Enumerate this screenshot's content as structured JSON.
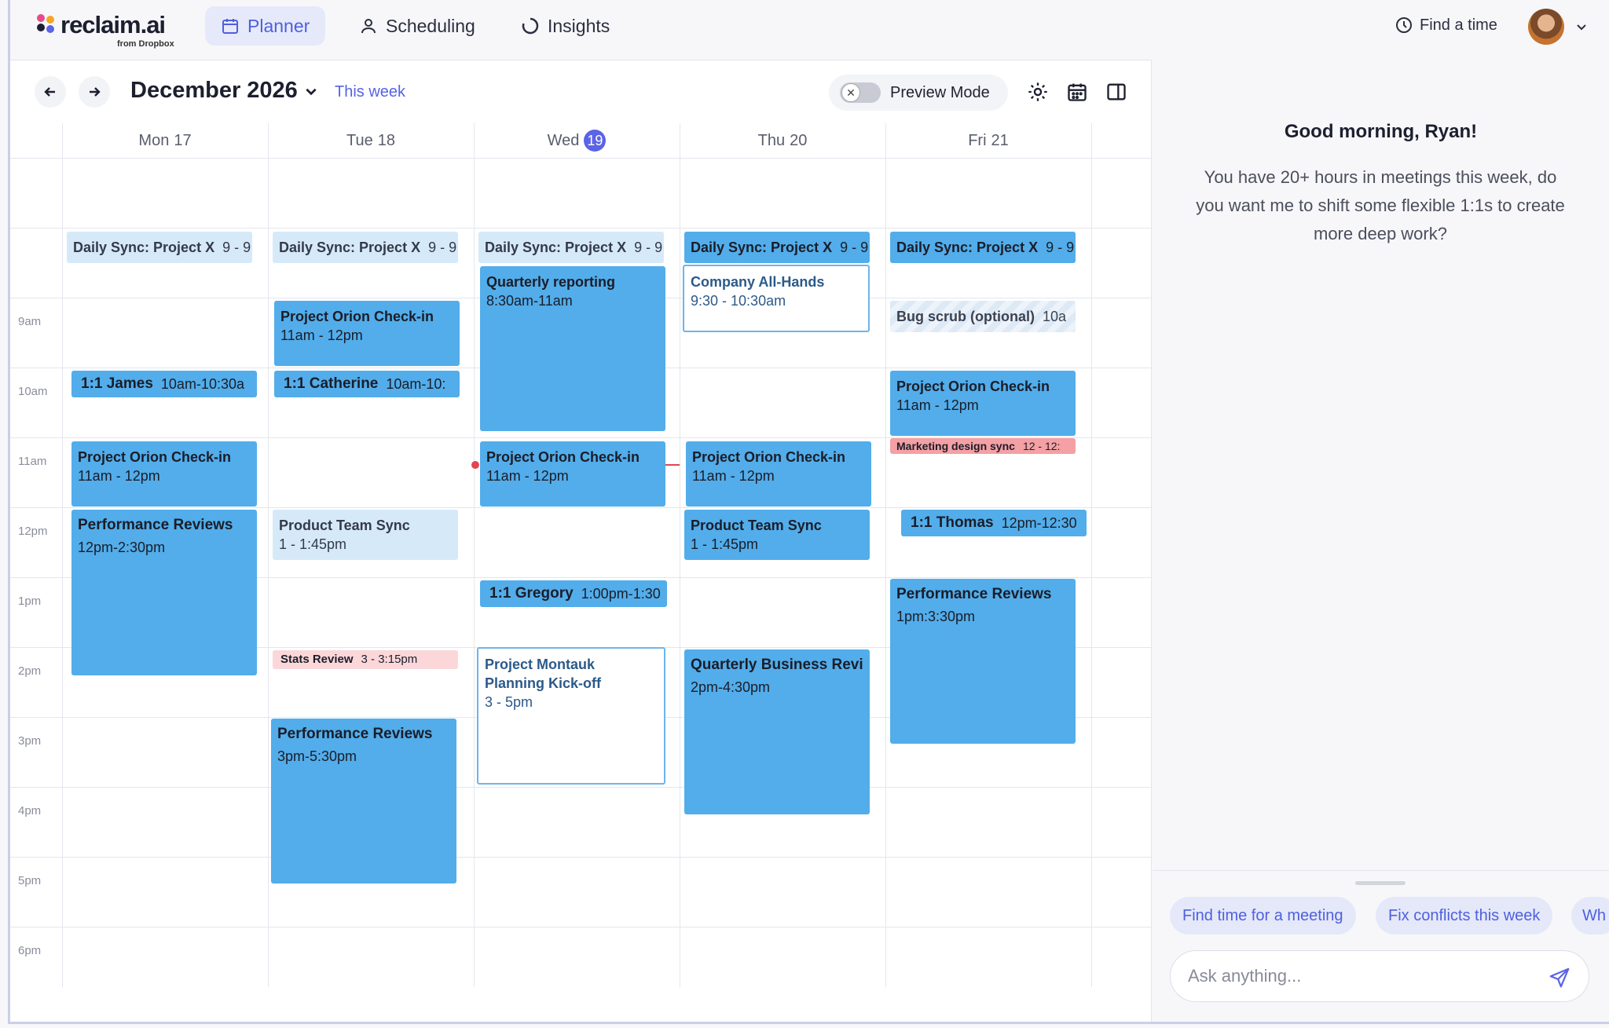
{
  "brand": {
    "name": "reclaim.ai",
    "sub": "from Dropbox"
  },
  "nav": {
    "tabs": [
      {
        "label": "Planner"
      },
      {
        "label": "Scheduling"
      },
      {
        "label": "Insights"
      }
    ],
    "find_time": "Find a time"
  },
  "toolbar": {
    "month": "December 2026",
    "this_week": "This week",
    "preview_mode": "Preview Mode"
  },
  "days": [
    {
      "name": "Mon",
      "num": "17"
    },
    {
      "name": "Tue",
      "num": "18"
    },
    {
      "name": "Wed",
      "num": "19"
    },
    {
      "name": "Thu",
      "num": "20"
    },
    {
      "name": "Fri",
      "num": "21"
    }
  ],
  "hours": [
    "9am",
    "10am",
    "11am",
    "12pm",
    "1pm",
    "2pm",
    "3pm",
    "4pm",
    "5pm",
    "6pm"
  ],
  "events": {
    "mon": [
      {
        "title": "Daily Sync: Project X",
        "time": "9 - 9"
      },
      {
        "title": "1:1 James",
        "time": "10am-10:30a"
      },
      {
        "title": "Project Orion Check-in",
        "time": "11am - 12pm"
      },
      {
        "title": "Performance Reviews",
        "time": "12pm-2:30pm"
      }
    ],
    "tue": [
      {
        "title": "Daily Sync: Project X",
        "time": "9 - 9"
      },
      {
        "title": "Project Orion Check-in",
        "time": "11am - 12pm"
      },
      {
        "title": "1:1 Catherine",
        "time": "10am-10:"
      },
      {
        "title": "Product Team Sync",
        "time": "1 - 1:45pm"
      },
      {
        "title": "Stats Review",
        "time": "3 - 3:15pm"
      },
      {
        "title": "Performance Reviews",
        "time": "3pm-5:30pm"
      }
    ],
    "wed": [
      {
        "title": "Daily Sync: Project X",
        "time": "9 - 9"
      },
      {
        "title": "Quarterly reporting",
        "time": "8:30am-11am"
      },
      {
        "title": "Project Orion Check-in",
        "time": "11am - 12pm"
      },
      {
        "title": "1:1 Gregory",
        "time": "1:00pm-1:30"
      },
      {
        "title": "Project Montauk",
        "title2": "Planning Kick-off",
        "time": "3 - 5pm"
      }
    ],
    "thu": [
      {
        "title": "Daily Sync: Project X",
        "time": "9 - 9"
      },
      {
        "title": "Company All-Hands",
        "time": "9:30 - 10:30am"
      },
      {
        "title": "Project Orion Check-in",
        "time": "11am - 12pm"
      },
      {
        "title": "Product Team Sync",
        "time": "1 - 1:45pm"
      },
      {
        "title": "Quarterly Business Revi",
        "time": "2pm-4:30pm"
      }
    ],
    "fri": [
      {
        "title": "Daily Sync: Project X",
        "time": "9 - 9"
      },
      {
        "title": "Bug scrub (optional)",
        "time": "10a"
      },
      {
        "title": "Project Orion Check-in",
        "time": "11am - 12pm"
      },
      {
        "title": "Marketing design sync",
        "time": "12 - 12:"
      },
      {
        "title": "1:1 Thomas",
        "time": "12pm-12:30"
      },
      {
        "title": "Performance Reviews",
        "time": "1pm:3:30pm"
      }
    ]
  },
  "assistant": {
    "greeting": "Good morning, Ryan!",
    "message": "You have 20+ hours in meetings this week, do you want me to shift some flexible 1:1s to create more deep work?",
    "chips": [
      "Find time for a meeting",
      "Fix conflicts this week",
      "Wh"
    ],
    "input_placeholder": "Ask anything..."
  },
  "colors": {
    "accent": "#5b63e6",
    "event_blue": "#52adea",
    "now_line": "#e4454f"
  }
}
